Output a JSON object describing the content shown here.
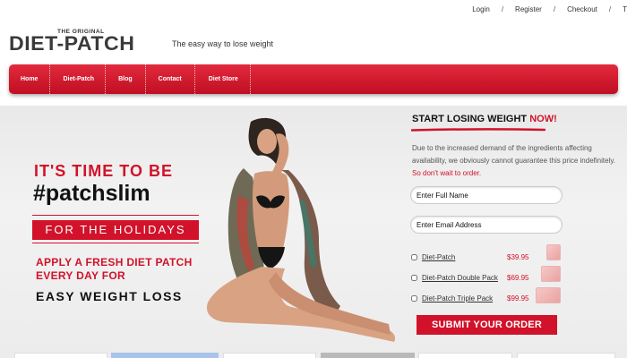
{
  "toplinks": {
    "login": "Login",
    "register": "Register",
    "checkout": "Checkout",
    "more": "T",
    "sep": "/"
  },
  "logo": {
    "small": "THE ORIGINAL",
    "main": "DIET-PATCH"
  },
  "tagline": "The easy way to lose weight",
  "nav": {
    "items": [
      "Home",
      "Diet-Patch",
      "Blog",
      "Contact",
      "Diet Store"
    ]
  },
  "hero": {
    "headline1": "IT'S TIME TO BE",
    "headline2": "#patchslim",
    "band": "FOR THE HOLIDAYS",
    "apply": "APPLY A FRESH DIET PATCH EVERY DAY FOR",
    "easy": "EASY WEIGHT LOSS"
  },
  "order": {
    "title_main": "START LOSING WEIGHT ",
    "title_accent": "NOW!",
    "notice": "Due to the increased demand of the ingredients affecting availability, we obviously cannot guarantee this price indefinitely. ",
    "notice_red": "So don't wait to order.",
    "name_placeholder": "Enter Full Name",
    "email_placeholder": "Enter Email Address",
    "products": [
      {
        "name": "Diet-Patch",
        "price": "$39.95"
      },
      {
        "name": "Diet-Patch Double Pack",
        "price": "$69.95"
      },
      {
        "name": "Diet-Patch Triple Pack",
        "price": "$99.95"
      }
    ],
    "submit": "SUBMIT YOUR ORDER"
  },
  "colors": {
    "brand_red": "#d1122a",
    "nav_red": "#e22a3d",
    "dark": "#111111"
  }
}
